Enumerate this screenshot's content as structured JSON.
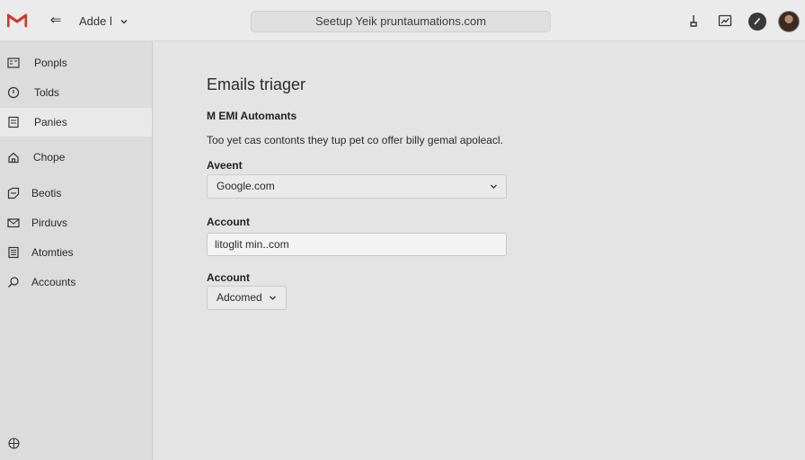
{
  "header": {
    "account_label": "Adde l",
    "search_text": "Seetup Yeik pruntaumations.com",
    "icons": [
      "gmail-logo-icon",
      "back-arrow-icon",
      "chevron-down-icon",
      "key-icon",
      "chart-icon",
      "edit-icon",
      "avatar"
    ]
  },
  "sidebar": {
    "items": [
      {
        "label": "Ponpls",
        "icon": "inbox-icon"
      },
      {
        "label": "Tolds",
        "icon": "info-icon"
      },
      {
        "label": "Panies",
        "icon": "document-icon"
      },
      {
        "label": "Chope",
        "icon": "home-icon"
      },
      {
        "label": "Beotis",
        "icon": "tag-icon"
      },
      {
        "label": "Pirduvs",
        "icon": "mail-icon"
      },
      {
        "label": "Atomties",
        "icon": "list-icon"
      },
      {
        "label": "Accounts",
        "icon": "search-icon"
      }
    ],
    "active_index": 2
  },
  "main": {
    "title": "Emails triager",
    "section_title": "M EMI Automants",
    "description": "Too yet cas contonts they tup pet co offer billy gemal apoleacl.",
    "fields": [
      {
        "label": "Aveent",
        "value": "Google.com"
      },
      {
        "label": "Account",
        "value": "litoglit min..com"
      },
      {
        "label": "Account",
        "value": "Adcomed"
      }
    ]
  },
  "colors": {
    "gmail_red": "#d93025",
    "background": "#e4e4e4",
    "sidebar": "#dcdcdc",
    "active_item": "#e9e9e9"
  }
}
